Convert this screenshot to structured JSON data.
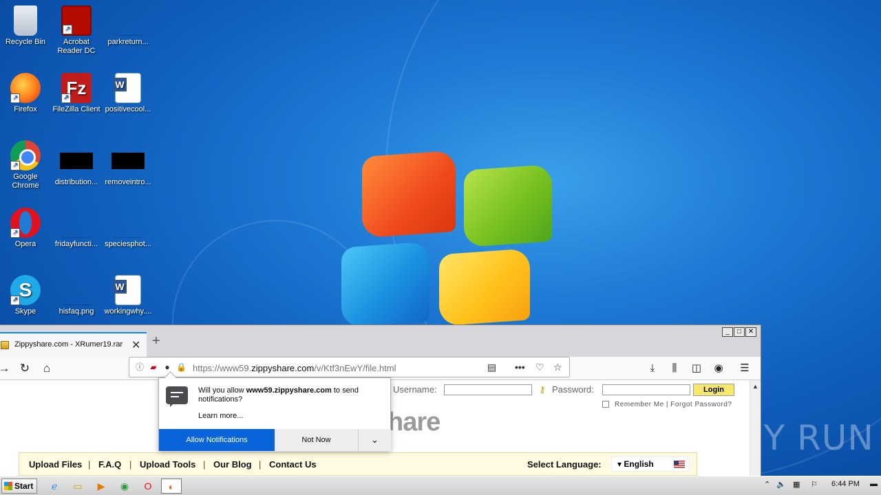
{
  "desktop": {
    "icons": [
      {
        "label": "Recycle Bin",
        "icon": "recycle-bin-icon"
      },
      {
        "label": "Acrobat Reader DC",
        "icon": "acrobat-icon"
      },
      {
        "label": "parkreturn...",
        "icon": "file-icon"
      },
      {
        "label": "Firefox",
        "icon": "firefox-icon"
      },
      {
        "label": "FileZilla Client",
        "icon": "filezilla-icon"
      },
      {
        "label": "positivecool...",
        "icon": "word-doc-icon"
      },
      {
        "label": "Google Chrome",
        "icon": "chrome-icon"
      },
      {
        "label": "distribution...",
        "icon": "file-icon"
      },
      {
        "label": "removeintro...",
        "icon": "file-icon"
      },
      {
        "label": "Opera",
        "icon": "opera-icon"
      },
      {
        "label": "fridayfuncti...",
        "icon": "file-icon"
      },
      {
        "label": "speciesphot...",
        "icon": "file-icon"
      },
      {
        "label": "Skype",
        "icon": "skype-icon"
      },
      {
        "label": "hisfaq.png",
        "icon": "image-icon"
      },
      {
        "label": "workingwhy....",
        "icon": "word-doc-icon"
      }
    ]
  },
  "browser": {
    "tab_title": "Zippyshare.com - XRumer19.rar",
    "new_tab": "+",
    "url_prefix": "https://www59.",
    "url_host": "zippyshare.com",
    "url_path": "/v/Ktf3nEwY/file.html",
    "window_controls": {
      "minimize": "_",
      "maximize": "□",
      "close": "✕"
    }
  },
  "page": {
    "username_label": "Username:",
    "password_label": "Password:",
    "login_button": "Login",
    "remember_me": "Remember Me",
    "forgot_password": "Forgot Password?",
    "brand_fragment": "hare",
    "menu": [
      "Upload Files",
      "F.A.Q",
      "Upload Tools",
      "Our Blog",
      "Contact Us"
    ],
    "select_language_label": "Select Language:",
    "language": "English"
  },
  "notification": {
    "message_pre": "Will you allow ",
    "message_site": "www59.zippyshare.com",
    "message_post": " to send notifications?",
    "learn_more": "Learn more...",
    "allow_button": "Allow Notifications",
    "not_now_button": "Not Now"
  },
  "watermark": "ANY RUN",
  "taskbar": {
    "start_label": "Start",
    "clock": "6:44 PM"
  }
}
